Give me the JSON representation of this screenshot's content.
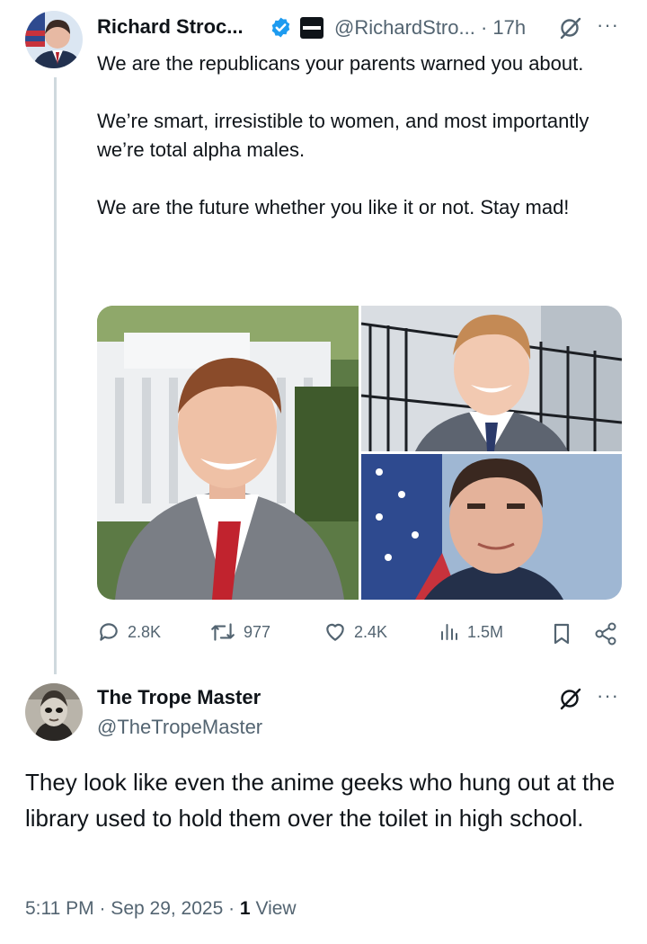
{
  "tweet": {
    "author_name": "Richard Stroc...",
    "handle_time": "@RichardStro... · 17h",
    "text": "We are the republicans your parents warned you about.\n\nWe’re smart, irresistible to women, and most importantly we’re total alpha males.\n\nWe are the future whether you like it or not. Stay mad!",
    "actions": {
      "replies": "2.8K",
      "reposts": "977",
      "likes": "2.4K",
      "views": "1.5M"
    }
  },
  "reply": {
    "author_name": "The Trope Master",
    "handle": "@TheTropeMaster",
    "text": "They look like even the anime geeks who hung out at the library used to hold them over the toilet in high school.",
    "timestamp": "5:11 PM · Sep 29, 2025 · ",
    "view_count": "1",
    "view_label": " View"
  },
  "colors": {
    "verified": "#1d9bf0",
    "muted_text": "#536471",
    "thread_line": "#cfd9de"
  }
}
